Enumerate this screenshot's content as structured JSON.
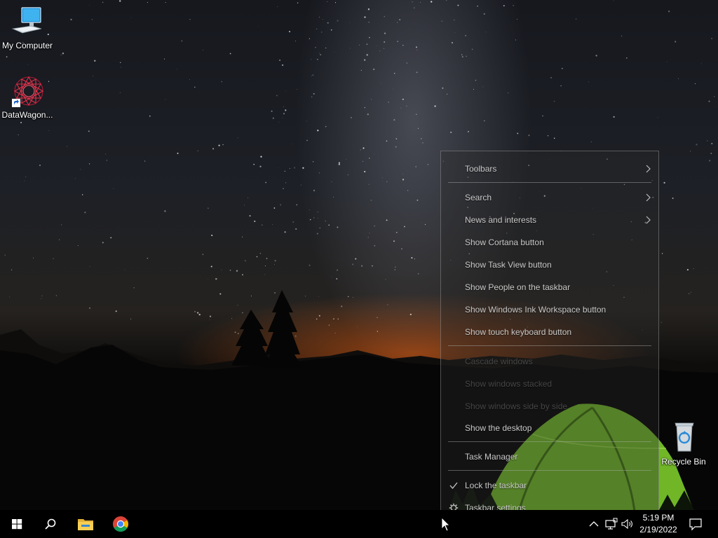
{
  "desktop": {
    "icons": {
      "my_computer": {
        "label": "My Computer",
        "icon": "monitor-icon"
      },
      "datawagon": {
        "label": "DataWagon...",
        "icon": "datawagon-app-icon"
      },
      "recycle_bin": {
        "label": "Recycle Bin",
        "icon": "recycle-bin-icon"
      }
    }
  },
  "context_menu": {
    "items": [
      {
        "label": "Toolbars",
        "has_submenu": true,
        "enabled": true
      },
      {
        "label": "Search",
        "has_submenu": true,
        "enabled": true
      },
      {
        "label": "News and interests",
        "has_submenu": true,
        "enabled": true
      },
      {
        "label": "Show Cortana button",
        "enabled": true
      },
      {
        "label": "Show Task View button",
        "enabled": true
      },
      {
        "label": "Show People on the taskbar",
        "enabled": true
      },
      {
        "label": "Show Windows Ink Workspace button",
        "enabled": true
      },
      {
        "label": "Show touch keyboard button",
        "enabled": true
      },
      {
        "label": "Cascade windows",
        "enabled": false
      },
      {
        "label": "Show windows stacked",
        "enabled": false
      },
      {
        "label": "Show windows side by side",
        "enabled": false
      },
      {
        "label": "Show the desktop",
        "enabled": true
      },
      {
        "label": "Task Manager",
        "enabled": true
      },
      {
        "label": "Lock the taskbar",
        "checked": true,
        "enabled": true
      },
      {
        "label": "Taskbar settings",
        "icon": "gear-icon",
        "enabled": true
      }
    ]
  },
  "taskbar": {
    "pinned": [
      "windows-start-icon",
      "search-icon",
      "file-explorer-icon",
      "chrome-icon"
    ],
    "tray": [
      "chevron-up-icon",
      "network-icon",
      "volume-icon",
      "notification-icon"
    ],
    "clock": {
      "time": "5:19 PM",
      "date": "2/19/2022"
    }
  },
  "colors": {
    "taskbar": "#000000",
    "menu_text": "#c9c9c9",
    "sky_glow": "#e05f14",
    "tent_green": "#7fcf2c"
  }
}
